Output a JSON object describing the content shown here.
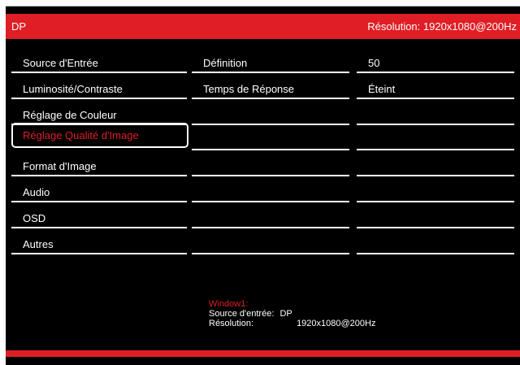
{
  "header": {
    "source": "DP",
    "resolution": "Résolution: 1920x1080@200Hz"
  },
  "menu": {
    "items": [
      {
        "label": "Source d'Entrée"
      },
      {
        "label": "Luminosité/Contraste"
      },
      {
        "label": "Réglage de Couleur"
      },
      {
        "label": "Réglage Qualité d'Image",
        "selected": true
      },
      {
        "label": "Format d'Image"
      },
      {
        "label": "Audio"
      },
      {
        "label": "OSD"
      },
      {
        "label": "Autres"
      }
    ]
  },
  "submenu": {
    "rows": [
      {
        "label": "Définition",
        "value": "50"
      },
      {
        "label": "Temps de Réponse",
        "value": "Éteint"
      }
    ]
  },
  "info": {
    "window": "Window1:",
    "source_label": "Source d'entrée:",
    "source_value": "DP",
    "resolution_label": "Résolution:",
    "resolution_value": "1920x1080@200Hz"
  },
  "colors": {
    "accent": "#e01e26",
    "background": "#000000",
    "text": "#ffffff"
  }
}
